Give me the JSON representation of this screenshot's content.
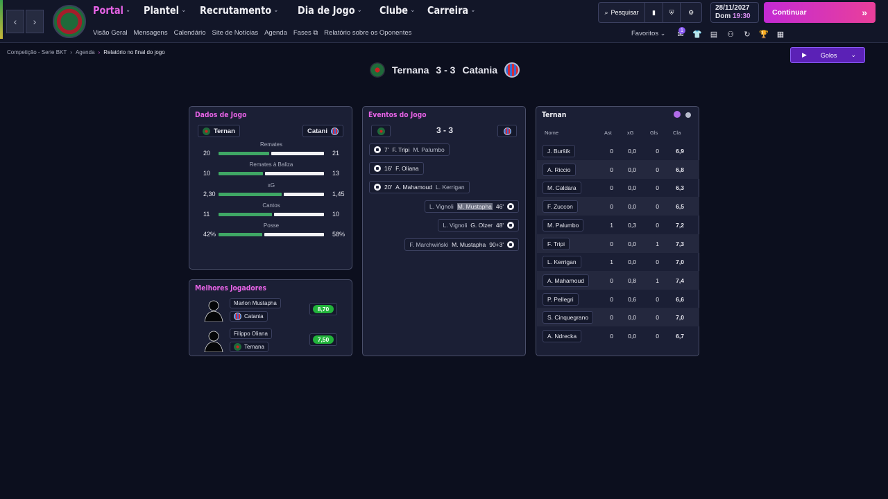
{
  "nav": {
    "main": [
      {
        "label": "Portal",
        "active": true
      },
      {
        "label": "Plantel",
        "active": false
      },
      {
        "label": "Recrutamento",
        "active": false
      },
      {
        "label": "Dia de Jogo",
        "active": false
      },
      {
        "label": "Clube",
        "active": false
      },
      {
        "label": "Carreira",
        "active": false
      }
    ],
    "sub": [
      "Visão Geral",
      "Mensagens",
      "Calendário",
      "Site de Notícias",
      "Agenda",
      "Fases",
      "Relatório sobre os Oponentes"
    ],
    "search_label": "Pesquisar",
    "date": "28/11/2027",
    "day": "Dom",
    "time": "19:30",
    "continue_label": "Continuar",
    "favorites_label": "Favoritos",
    "inbox_badge": "1"
  },
  "breadcrumb": [
    "Competição - Serie BKT",
    "Agenda",
    "Relatório no final do jogo"
  ],
  "golos_button": "Golos",
  "match": {
    "home": "Ternana",
    "away": "Catania",
    "score": "3 - 3"
  },
  "dados": {
    "title": "Dados de Jogo",
    "home_chip": "Ternan",
    "away_chip": "Catani",
    "stats": [
      {
        "label": "Remates",
        "home": "20",
        "away": "21",
        "home_frac": 0.49
      },
      {
        "label": "Remates à Baliza",
        "home": "10",
        "away": "13",
        "home_frac": 0.43
      },
      {
        "label": "xG",
        "home": "2,30",
        "away": "1,45",
        "home_frac": 0.61
      },
      {
        "label": "Cantos",
        "home": "11",
        "away": "10",
        "home_frac": 0.52
      },
      {
        "label": "Posse",
        "home": "42%",
        "away": "58%",
        "home_frac": 0.42
      }
    ]
  },
  "best": {
    "title": "Melhores Jogadores",
    "players": [
      {
        "name": "Marlon Mustapha",
        "club": "Catania",
        "rating": "8,70"
      },
      {
        "name": "Filippo Oliana",
        "club": "Ternana",
        "rating": "7,50"
      }
    ]
  },
  "events": {
    "title": "Eventos do Jogo",
    "score": "3 - 3",
    "home": [
      {
        "minute": "7'",
        "scorer": "F. Tripi",
        "assist": "M. Palumbo"
      },
      {
        "minute": "16'",
        "scorer": "F. Oliana",
        "assist": ""
      },
      {
        "minute": "20'",
        "scorer": "A. Mahamoud",
        "assist": "L. Kerrigan"
      }
    ],
    "away": [
      {
        "assist": "L. Vignoli",
        "scorer": "M. Mustapha",
        "minute": "46'"
      },
      {
        "assist": "L. Vignoli",
        "scorer": "G. Olzer",
        "minute": "48'"
      },
      {
        "assist": "F. Marchwiński",
        "scorer": "M. Mustapha",
        "minute": "90+3'"
      }
    ]
  },
  "ratings": {
    "title": "Ternan",
    "columns": [
      "Nome",
      "Ast",
      "xG",
      "Gls",
      "Cla"
    ],
    "dot_colors": [
      "#b06be8",
      "#b8bccc"
    ],
    "rows": [
      [
        "J. Buršík",
        "0",
        "0,0",
        "0",
        "6,9"
      ],
      [
        "A. Riccio",
        "0",
        "0,0",
        "0",
        "6,8"
      ],
      [
        "M. Caldara",
        "0",
        "0,0",
        "0",
        "6,3"
      ],
      [
        "F. Zuccon",
        "0",
        "0,0",
        "0",
        "6,5"
      ],
      [
        "M. Palumbo",
        "1",
        "0,3",
        "0",
        "7,2"
      ],
      [
        "F. Tripi",
        "0",
        "0,0",
        "1",
        "7,3"
      ],
      [
        "L. Kerrigan",
        "1",
        "0,0",
        "0",
        "7,0"
      ],
      [
        "A. Mahamoud",
        "0",
        "0,8",
        "1",
        "7,4"
      ],
      [
        "P. Pellegri",
        "0",
        "0,6",
        "0",
        "6,6"
      ],
      [
        "S. Cinquegrano",
        "0",
        "0,0",
        "0",
        "7,0"
      ],
      [
        "A. Ndrecka",
        "0",
        "0,0",
        "0",
        "6,7"
      ]
    ]
  }
}
